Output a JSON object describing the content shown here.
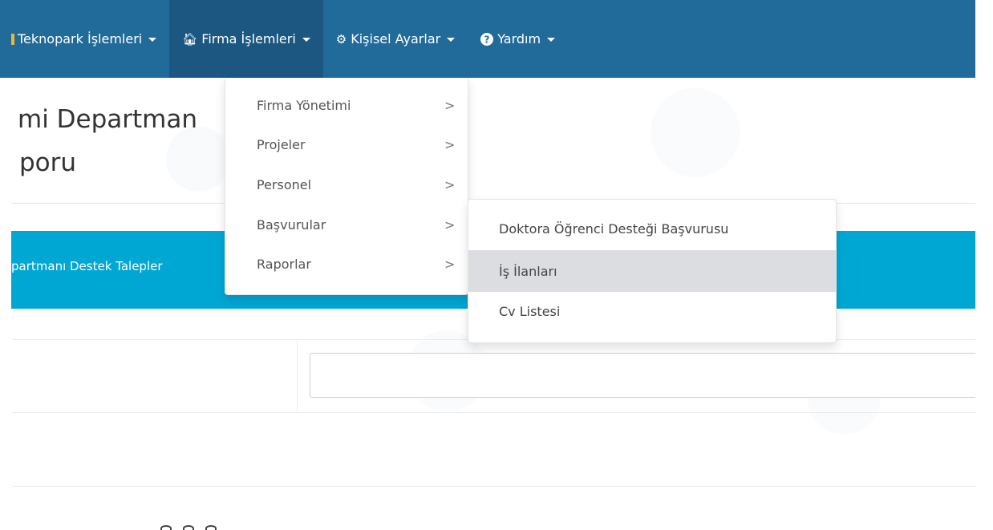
{
  "navbar": {
    "items": [
      {
        "label": "Teknopark İşlemleri",
        "icon": "bookmark-icon"
      },
      {
        "label": "Firma İşlemleri",
        "icon": "home-icon",
        "active": true
      },
      {
        "label": "Kişisel Ayarlar",
        "icon": "gears-icon"
      },
      {
        "label": "Yardım",
        "icon": "question-circle-icon"
      }
    ],
    "bg_color": "#216b9b",
    "active_color": "#1b5780"
  },
  "page_title": {
    "line1": "mi Departman",
    "line2": "poru"
  },
  "banner": {
    "text": "partmanı Destek Talepler",
    "color": "#00a7d3"
  },
  "dropdown": {
    "items": [
      {
        "label": "Firma Yönetimi",
        "chevron": ">"
      },
      {
        "label": "Projeler",
        "chevron": ">"
      },
      {
        "label": "Personel",
        "chevron": ">"
      },
      {
        "label": "Başvurular",
        "chevron": ">"
      },
      {
        "label": "Raporlar",
        "chevron": ">"
      }
    ]
  },
  "submenu": {
    "items": [
      {
        "label": "Doktora Öğrenci Desteği Başvurusu"
      },
      {
        "label": "İş İlanları",
        "hovered": true
      },
      {
        "label": "Cv Listesi"
      }
    ]
  }
}
